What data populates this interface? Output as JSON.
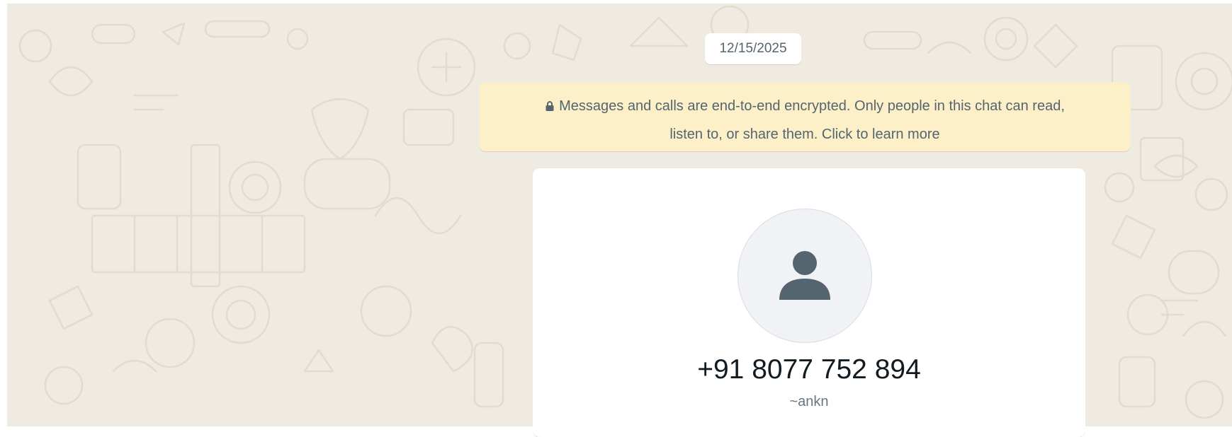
{
  "chat": {
    "date_label": "12/15/2025",
    "encryption_notice": {
      "line1": "Messages and calls are end-to-end encrypted. Only people in this chat can read,",
      "line2": "listen to, or share them. Click to learn more",
      "icon": "lock-icon"
    },
    "contact_card": {
      "avatar_icon": "default-person-icon",
      "phone": "+91 8077 752 894",
      "alias": "~ankn"
    }
  },
  "colors": {
    "chat_background": "#efeae2",
    "notice_background": "#fdf0c9",
    "card_background": "#ffffff",
    "avatar_icon": "#54656f"
  }
}
